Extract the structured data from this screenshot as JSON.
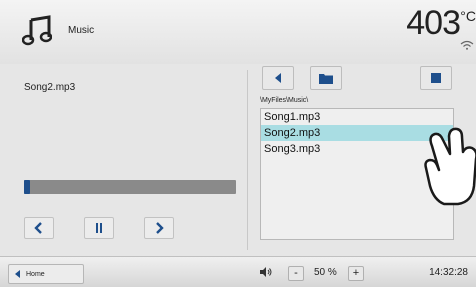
{
  "header": {
    "title": "Music",
    "temperature": "403",
    "unit": "°C"
  },
  "player": {
    "current_song": "Song2.mp3",
    "progress_fraction": 0.03,
    "prev_label": "<",
    "next_label": ">"
  },
  "browser": {
    "path": "\\MyFiles\\Music\\",
    "files": [
      "Song1.mp3",
      "Song2.mp3",
      "Song3.mp3"
    ],
    "selected_index": 1
  },
  "footer": {
    "home_label": "Home",
    "minus_label": "-",
    "plus_label": "+",
    "volume": "50 %",
    "time": "14:32:28"
  },
  "colors": {
    "accent": "#1e4f8c",
    "selection": "#a9dde3",
    "background": "#e6e6e6"
  },
  "icons": [
    "music-note-icon",
    "wifi-icon",
    "back-icon",
    "folder-icon",
    "pause-icon",
    "home-arrow-icon",
    "speaker-icon",
    "hand-pointer-icon"
  ]
}
